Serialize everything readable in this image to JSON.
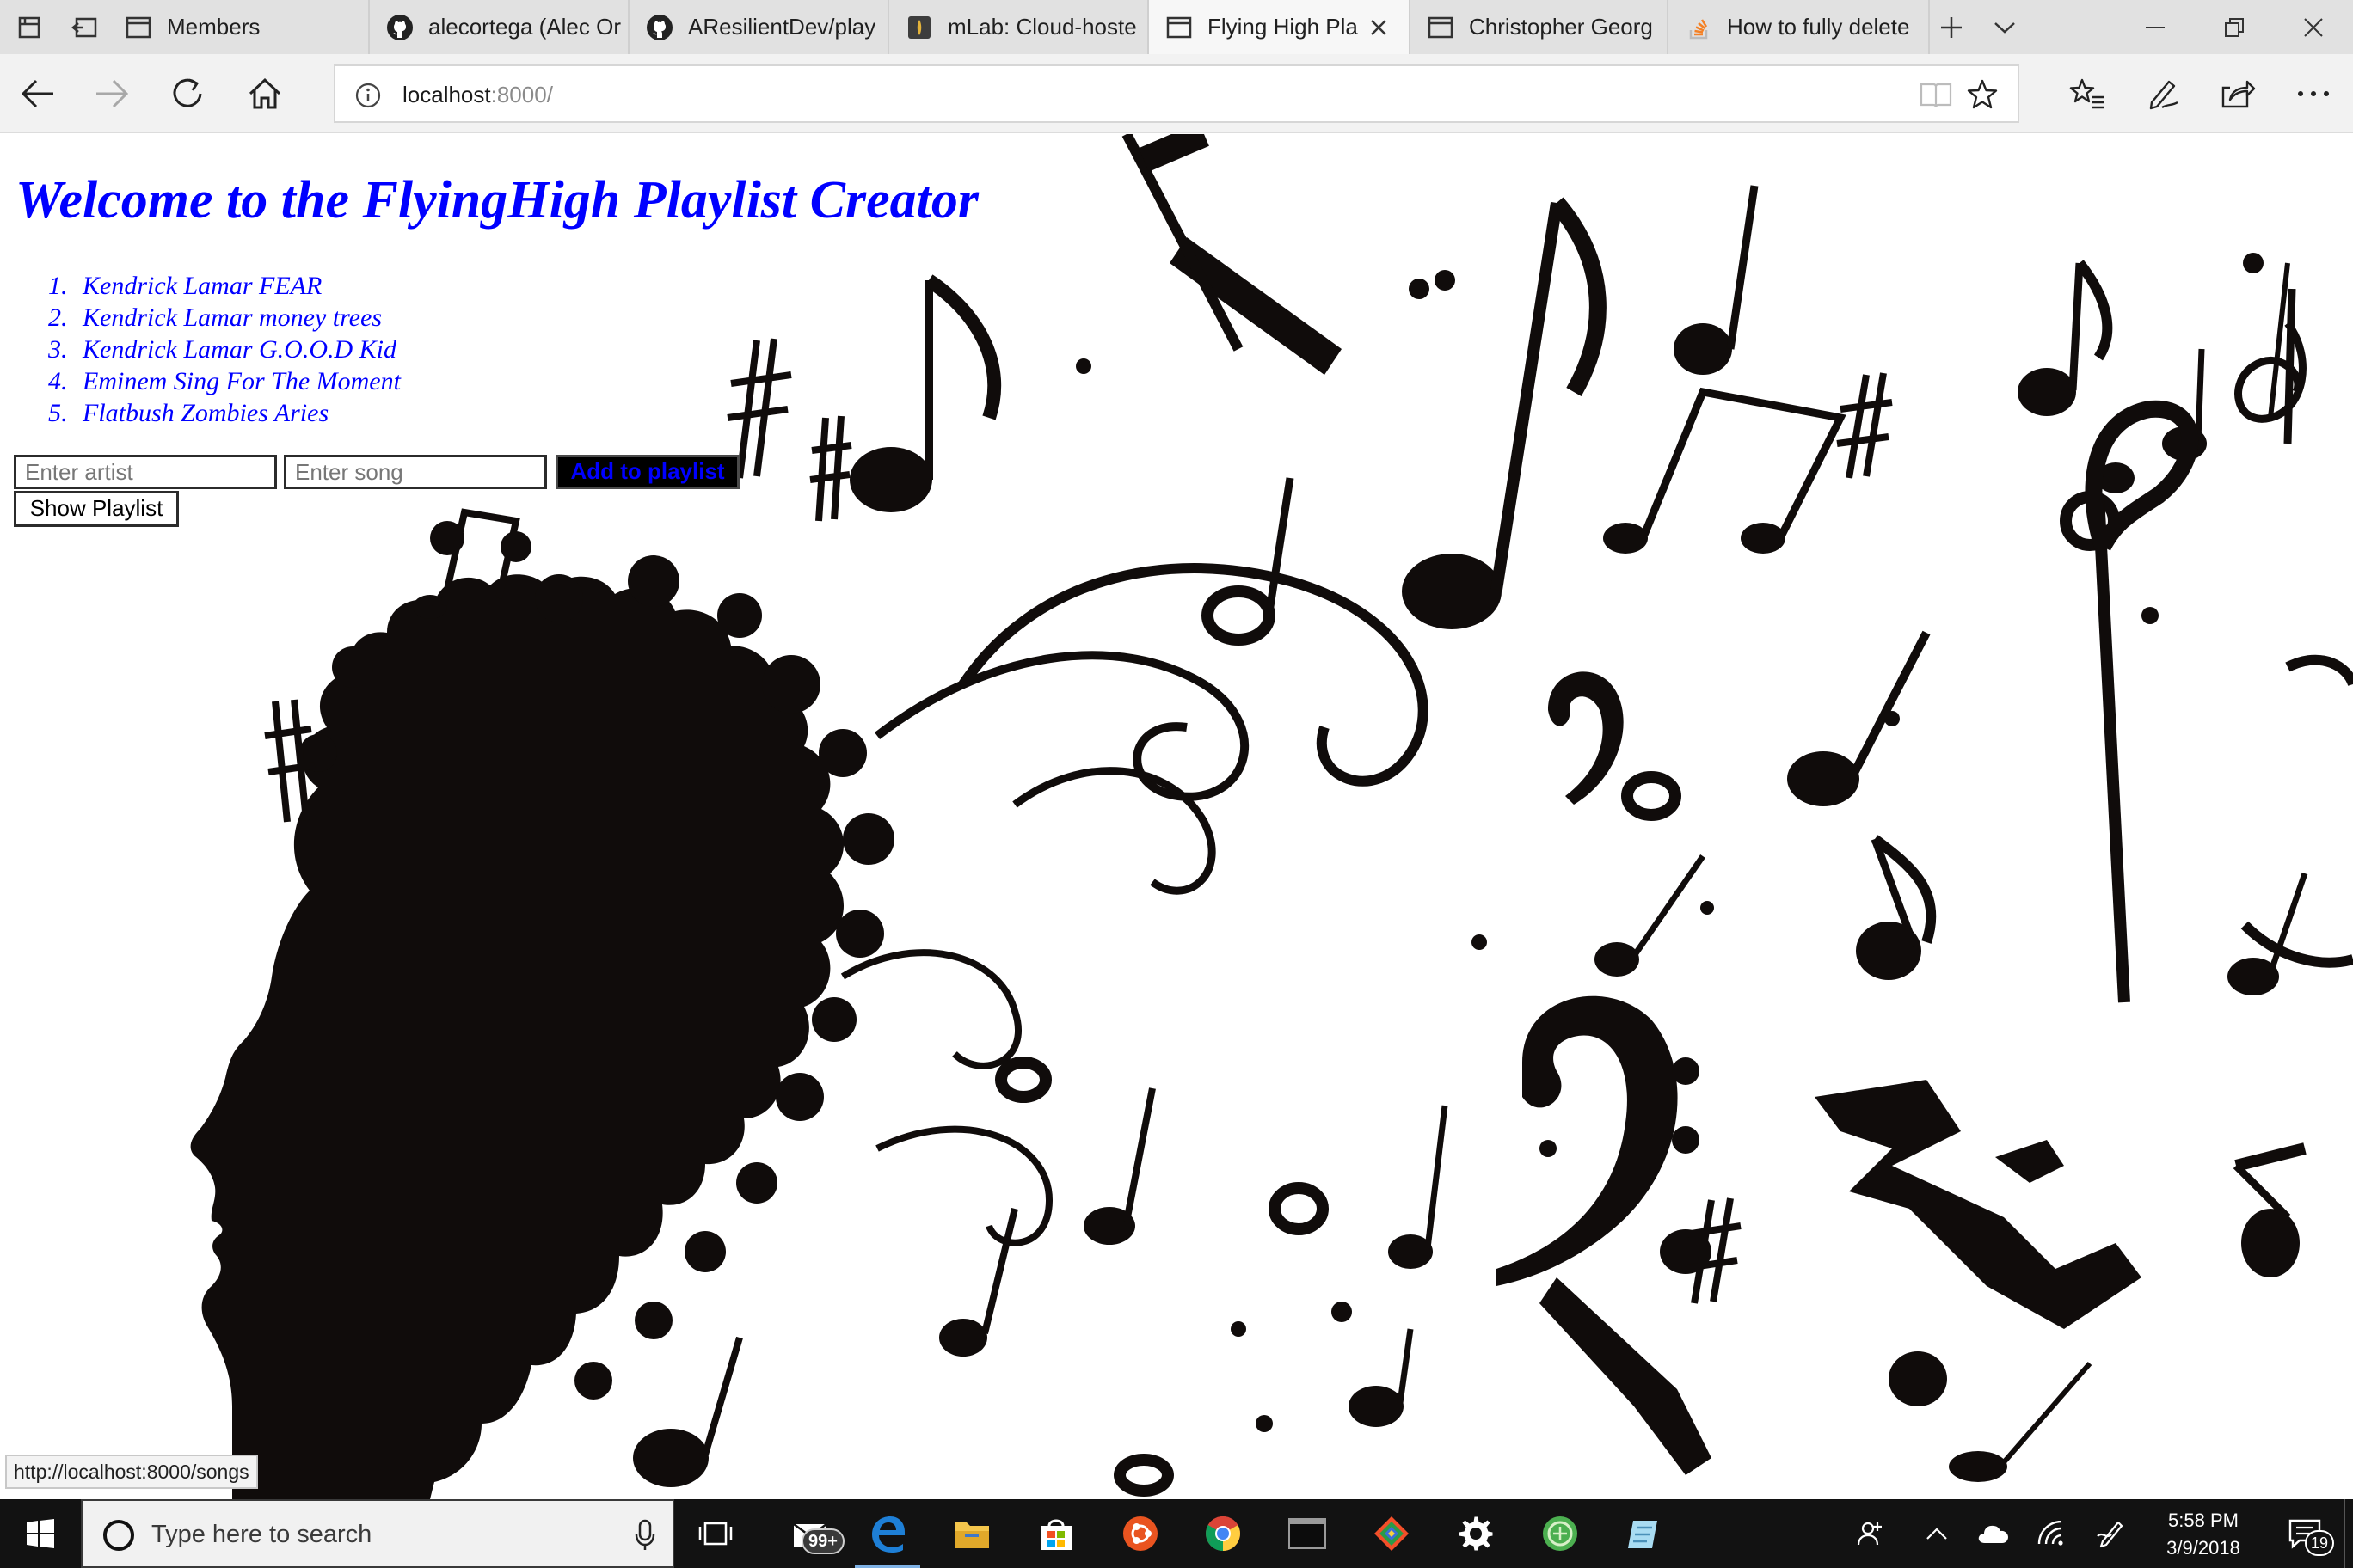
{
  "browser": {
    "tabs": [
      {
        "title": "Members",
        "icon": "page-icon"
      },
      {
        "title": "alecortega (Alec Or",
        "icon": "github-icon"
      },
      {
        "title": "AResilientDev/play",
        "icon": "github-icon"
      },
      {
        "title": "mLab: Cloud-hoste",
        "icon": "mlab-icon"
      },
      {
        "title": "Flying High Pla",
        "icon": "page-icon",
        "active": true
      },
      {
        "title": "Christopher Georg",
        "icon": "page-icon"
      },
      {
        "title": "How to fully delete",
        "icon": "stackoverflow-icon"
      }
    ],
    "address": {
      "host": "localhost",
      "port_path": ":8000/"
    }
  },
  "page": {
    "title": "Welcome to the FlyingHigh Playlist Creator",
    "playlist": [
      {
        "num": "1.",
        "text": "Kendrick Lamar FEAR"
      },
      {
        "num": "2.",
        "text": "Kendrick Lamar money trees"
      },
      {
        "num": "3.",
        "text": "Kendrick Lamar G.O.O.D Kid"
      },
      {
        "num": "4.",
        "text": "Eminem Sing For The Moment"
      },
      {
        "num": "5.",
        "text": "Flatbush Zombies Aries"
      }
    ],
    "form": {
      "artist_placeholder": "Enter artist",
      "song_placeholder": "Enter song",
      "add_label": "Add to playlist",
      "show_label": "Show Playlist"
    },
    "status_url": "http://localhost:8000/songs",
    "background": "black silhouette of a head with musical notes flowing from the hair"
  },
  "taskbar": {
    "search_placeholder": "Type here to search",
    "mail_badge": "99+",
    "time": "5:58 PM",
    "date": "3/9/2018",
    "notification_count": "19"
  },
  "colors": {
    "link_blue": "#0000ff",
    "tabbar": "#e1e1e1",
    "taskbar": "#121212",
    "edge_blue": "#1e7fd6"
  }
}
